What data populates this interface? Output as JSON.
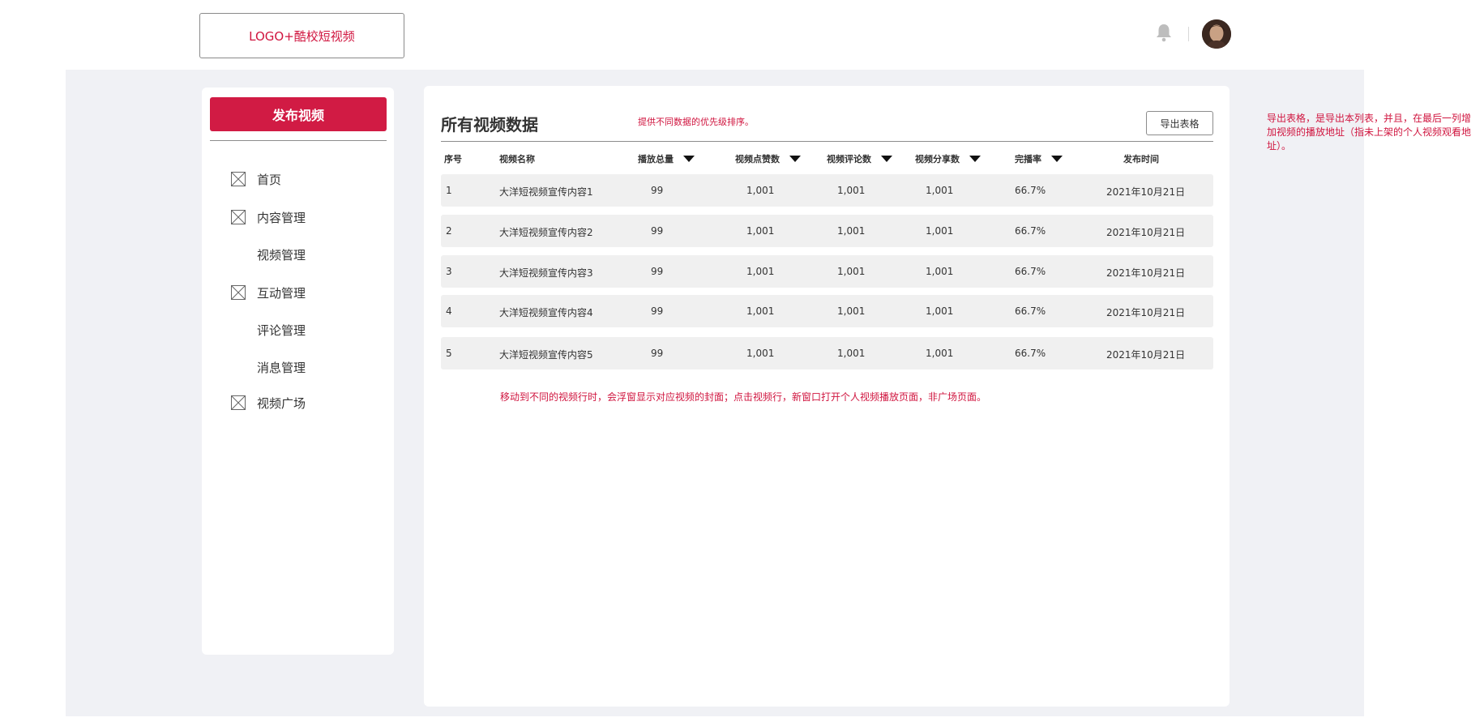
{
  "header": {
    "logo_text": "LOGO+酷校短视频"
  },
  "sidebar": {
    "publish_label": "发布视频",
    "items": [
      {
        "label": "首页",
        "icon": "placeholder-image-icon"
      },
      {
        "label": "内容管理",
        "icon": "placeholder-image-icon"
      },
      {
        "label": "视频管理",
        "icon": ""
      },
      {
        "label": "互动管理",
        "icon": "placeholder-image-icon"
      },
      {
        "label": "评论管理",
        "icon": ""
      },
      {
        "label": "消息管理",
        "icon": ""
      },
      {
        "label": "视频广场",
        "icon": "placeholder-image-icon"
      }
    ]
  },
  "main": {
    "title": "所有视频数据",
    "sort_note": "提供不同数据的优先级排序。",
    "export_label": "导出表格",
    "columns": [
      "序号",
      "视频名称",
      "播放总量",
      "视频点赞数",
      "视频评论数",
      "视频分享数",
      "完播率",
      "发布时间"
    ],
    "rows": [
      [
        "1",
        "大洋短视频宣传内容1",
        "99",
        "1,001",
        "1,001",
        "1,001",
        "66.7%",
        "2021年10月21日"
      ],
      [
        "2",
        "大洋短视频宣传内容2",
        "99",
        "1,001",
        "1,001",
        "1,001",
        "66.7%",
        "2021年10月21日"
      ],
      [
        "3",
        "大洋短视频宣传内容3",
        "99",
        "1,001",
        "1,001",
        "1,001",
        "66.7%",
        "2021年10月21日"
      ],
      [
        "4",
        "大洋短视频宣传内容4",
        "99",
        "1,001",
        "1,001",
        "1,001",
        "66.7%",
        "2021年10月21日"
      ],
      [
        "5",
        "大洋短视频宣传内容5",
        "99",
        "1,001",
        "1,001",
        "1,001",
        "66.7%",
        "2021年10月21日"
      ]
    ],
    "hover_note": "移动到不同的视频行时，会浮窗显示对应视频的封面；点击视频行，新窗口打开个人视频播放页面，非广场页面。"
  },
  "annotations": {
    "export_note": "导出表格，是导出本列表，并且，在最后一列增加视频的播放地址（指未上架的个人视频观看地址）。"
  },
  "colors": {
    "accent": "#d11b44",
    "annotation_red": "#d0153f",
    "background_grey": "#f0f1f5",
    "row_grey": "#f0f0f0"
  }
}
